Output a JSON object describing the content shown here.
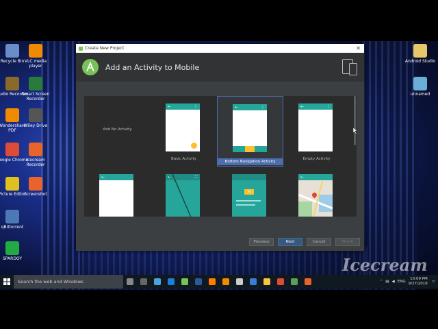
{
  "desktop": {
    "icons_left": [
      {
        "label": "Recycle Bin",
        "icon": "recycle-bin-icon",
        "color": "#6a8cc7"
      },
      {
        "label": "VLC media player",
        "icon": "vlc-icon",
        "color": "#f08a00"
      },
      {
        "label": "Audio Recorder",
        "icon": "audio-recorder-icon",
        "color": "#8a6a2a"
      },
      {
        "label": "Smart Screen Recorder",
        "icon": "screen-recorder-icon",
        "color": "#2a7a3a"
      },
      {
        "label": "Wondershare PDF",
        "icon": "pdf-icon",
        "color": "#f08a00"
      },
      {
        "label": "Wiley Drive",
        "icon": "drive-icon",
        "color": "#555555"
      },
      {
        "label": "Google Chrome",
        "icon": "chrome-icon",
        "color": "#dd4b39"
      },
      {
        "label": "Icecream Recorder",
        "icon": "icecream-icon",
        "color": "#e8642c"
      },
      {
        "label": "Picture Editor",
        "icon": "picture-editor-icon",
        "color": "#e0c020"
      },
      {
        "label": "Screenshot",
        "icon": "screenshot-icon",
        "color": "#e8642c"
      },
      {
        "label": "qBittorrent",
        "icon": "qbittorrent-icon",
        "color": "#4c79b5"
      },
      {
        "label": "SPARDOY",
        "icon": "spardoy-icon",
        "color": "#22aa44"
      }
    ],
    "icons_right": [
      {
        "label": "Android Studio",
        "icon": "folder-icon",
        "color": "#e8c66a"
      },
      {
        "label": "unnamed",
        "icon": "image-file-icon",
        "color": "#6aaed8"
      }
    ],
    "watermark": "Icecream"
  },
  "dialog": {
    "window_title": "Create New Project",
    "header_title": "Add an Activity to Mobile",
    "tiles": [
      {
        "label": "Add No Activity",
        "type": "none"
      },
      {
        "label": "Basic Activity",
        "type": "basic"
      },
      {
        "label": "Bottom Navigation Activity",
        "type": "bottom-nav",
        "selected": true
      },
      {
        "label": "Empty Activity",
        "type": "empty"
      },
      {
        "label": "",
        "type": "fullscreen-list"
      },
      {
        "label": "",
        "type": "fullscreen"
      },
      {
        "label": "",
        "type": "ad"
      },
      {
        "label": "",
        "type": "maps"
      }
    ],
    "ad_text": "Ad",
    "buttons": {
      "previous": "Previous",
      "next": "Next",
      "cancel": "Cancel",
      "finish": "Finish"
    },
    "accent_color": "#26a69a",
    "selection_color": "#4b6eaf"
  },
  "taskbar": {
    "search_placeholder": "Search the web and Windows",
    "language": "ENG",
    "time": "10:09 PM",
    "date": "9/27/2018",
    "pinned": [
      "task-view-icon",
      "store-icon",
      "link-icon",
      "edge-icon",
      "android-studio-icon",
      "photoshop-icon",
      "illustrator-icon",
      "vlc-icon",
      "download-icon",
      "settings-icon",
      "file-explorer-icon",
      "chrome-icon",
      "camera-icon",
      "icecream-icon"
    ]
  }
}
